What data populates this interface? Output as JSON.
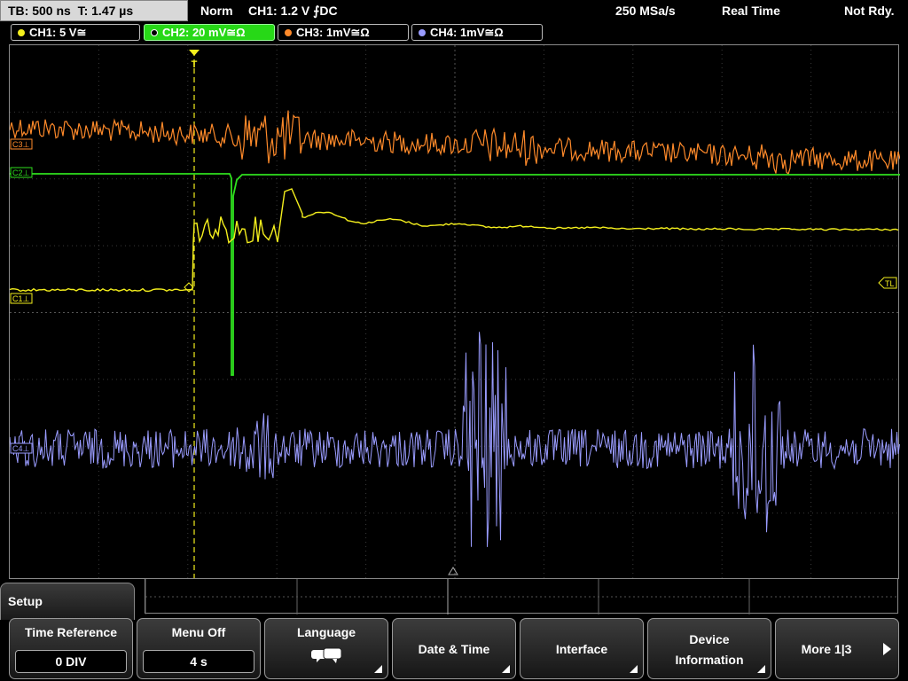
{
  "status": {
    "timebase": "TB: 500 ns",
    "trigger_time": "T: 1.47 µs",
    "mode": "Norm",
    "trigger": "CH1: 1.2 V ⨍DC",
    "sample_rate": "250 MSa/s",
    "acq": "Real Time",
    "state": "Not Rdy."
  },
  "channels": [
    {
      "label": "CH1: 5 V≅",
      "color": "#f4ef1d"
    },
    {
      "label": "CH2: 20 mV≅Ω",
      "color": "#2fe01e"
    },
    {
      "label": "CH3: 1mV≅Ω",
      "color": "#ff8a2a"
    },
    {
      "label": "CH4: 1mV≅Ω",
      "color": "#9a9cff"
    }
  ],
  "markers": {
    "c3": "C3⊥",
    "c2": "C2⊥",
    "c1": "C1⊥",
    "c4": "C4⊥",
    "trigger_level": "TL",
    "trigger_pos": "T"
  },
  "menu": {
    "title": "Setup",
    "softkeys": [
      {
        "label": "Time Reference",
        "value": "0 DIV"
      },
      {
        "label": "Menu Off",
        "value": "4 s"
      },
      {
        "label": "Language",
        "icon": "speech-bubbles-icon"
      },
      {
        "label": "Date & Time"
      },
      {
        "label": "Interface"
      },
      {
        "label_line1": "Device",
        "label_line2": "Information"
      },
      {
        "label": "More 1|3"
      }
    ]
  }
}
